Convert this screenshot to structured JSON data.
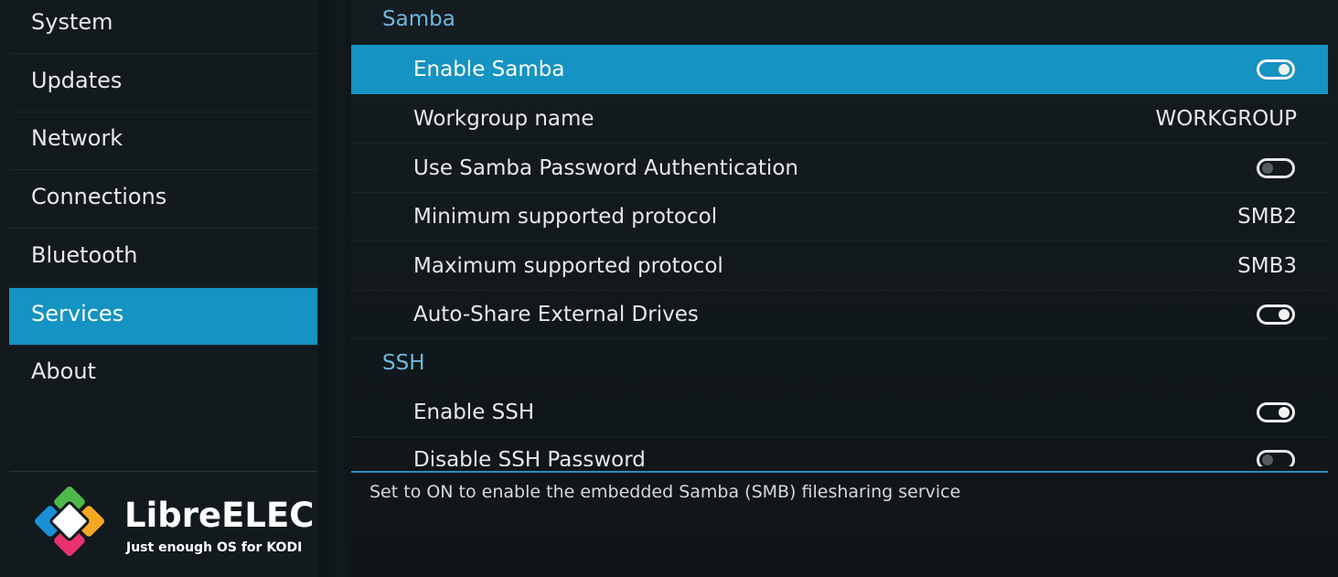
{
  "sidebar": {
    "items": [
      {
        "label": "System"
      },
      {
        "label": "Updates"
      },
      {
        "label": "Network"
      },
      {
        "label": "Connections"
      },
      {
        "label": "Bluetooth"
      },
      {
        "label": "Services",
        "active": true
      },
      {
        "label": "About"
      }
    ]
  },
  "brand": {
    "name": "LibreELEC",
    "tagline": "Just enough OS for KODI",
    "colors": [
      "#f7a823",
      "#e8336f",
      "#1a8fd6",
      "#4fb84a"
    ]
  },
  "sections": {
    "samba": {
      "title": "Samba",
      "rows": [
        {
          "label": "Enable Samba",
          "toggle": "on"
        },
        {
          "label": "Workgroup name",
          "value": "WORKGROUP"
        },
        {
          "label": "Use Samba Password Authentication",
          "toggle": "off"
        },
        {
          "label": "Minimum supported protocol",
          "value": "SMB2"
        },
        {
          "label": "Maximum supported protocol",
          "value": "SMB3"
        },
        {
          "label": "Auto-Share External Drives",
          "toggle": "on"
        }
      ]
    },
    "ssh": {
      "title": "SSH",
      "rows": [
        {
          "label": "Enable SSH",
          "toggle": "on"
        },
        {
          "label": "Disable SSH Password",
          "toggle": "off"
        }
      ]
    }
  },
  "help": {
    "text": "Set to ON to enable the embedded Samba (SMB) filesharing service"
  },
  "colors": {
    "accent": "#1593c2",
    "section_label": "#6fb8df",
    "background": "#0c1114"
  }
}
